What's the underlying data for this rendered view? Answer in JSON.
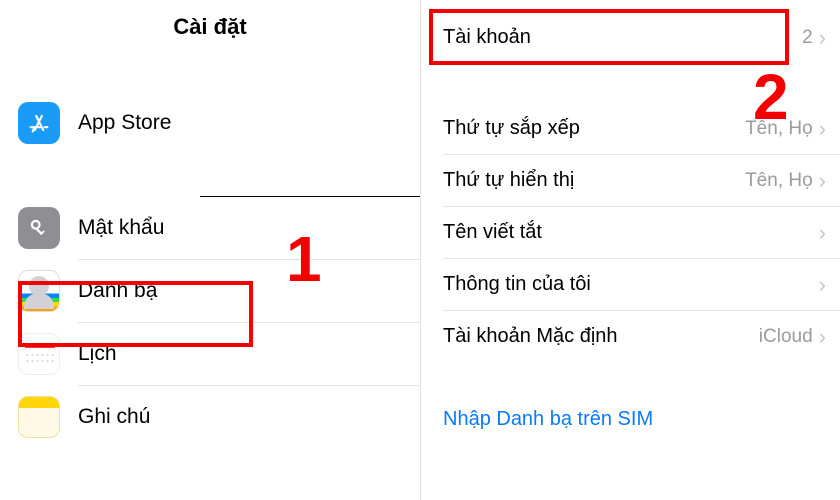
{
  "left": {
    "title": "Cài đặt",
    "rows": {
      "appstore": "App Store",
      "passwords": "Mật khẩu",
      "contacts": "Danh bạ",
      "calendar": "Lịch",
      "notes": "Ghi chú"
    }
  },
  "right": {
    "accounts": {
      "label": "Tài khoản",
      "value": "2"
    },
    "sortOrder": {
      "label": "Thứ tự sắp xếp",
      "value": "Tên, Họ"
    },
    "displayOrder": {
      "label": "Thứ tự hiển thị",
      "value": "Tên, Họ"
    },
    "shortName": {
      "label": "Tên viết tắt",
      "value": ""
    },
    "myInfo": {
      "label": "Thông tin của tôi",
      "value": ""
    },
    "defaultAccount": {
      "label": "Tài khoản Mặc định",
      "value": "iCloud"
    },
    "importSim": {
      "label": "Nhập Danh bạ trên SIM"
    }
  },
  "annotations": {
    "num1": "1",
    "num2": "2"
  }
}
